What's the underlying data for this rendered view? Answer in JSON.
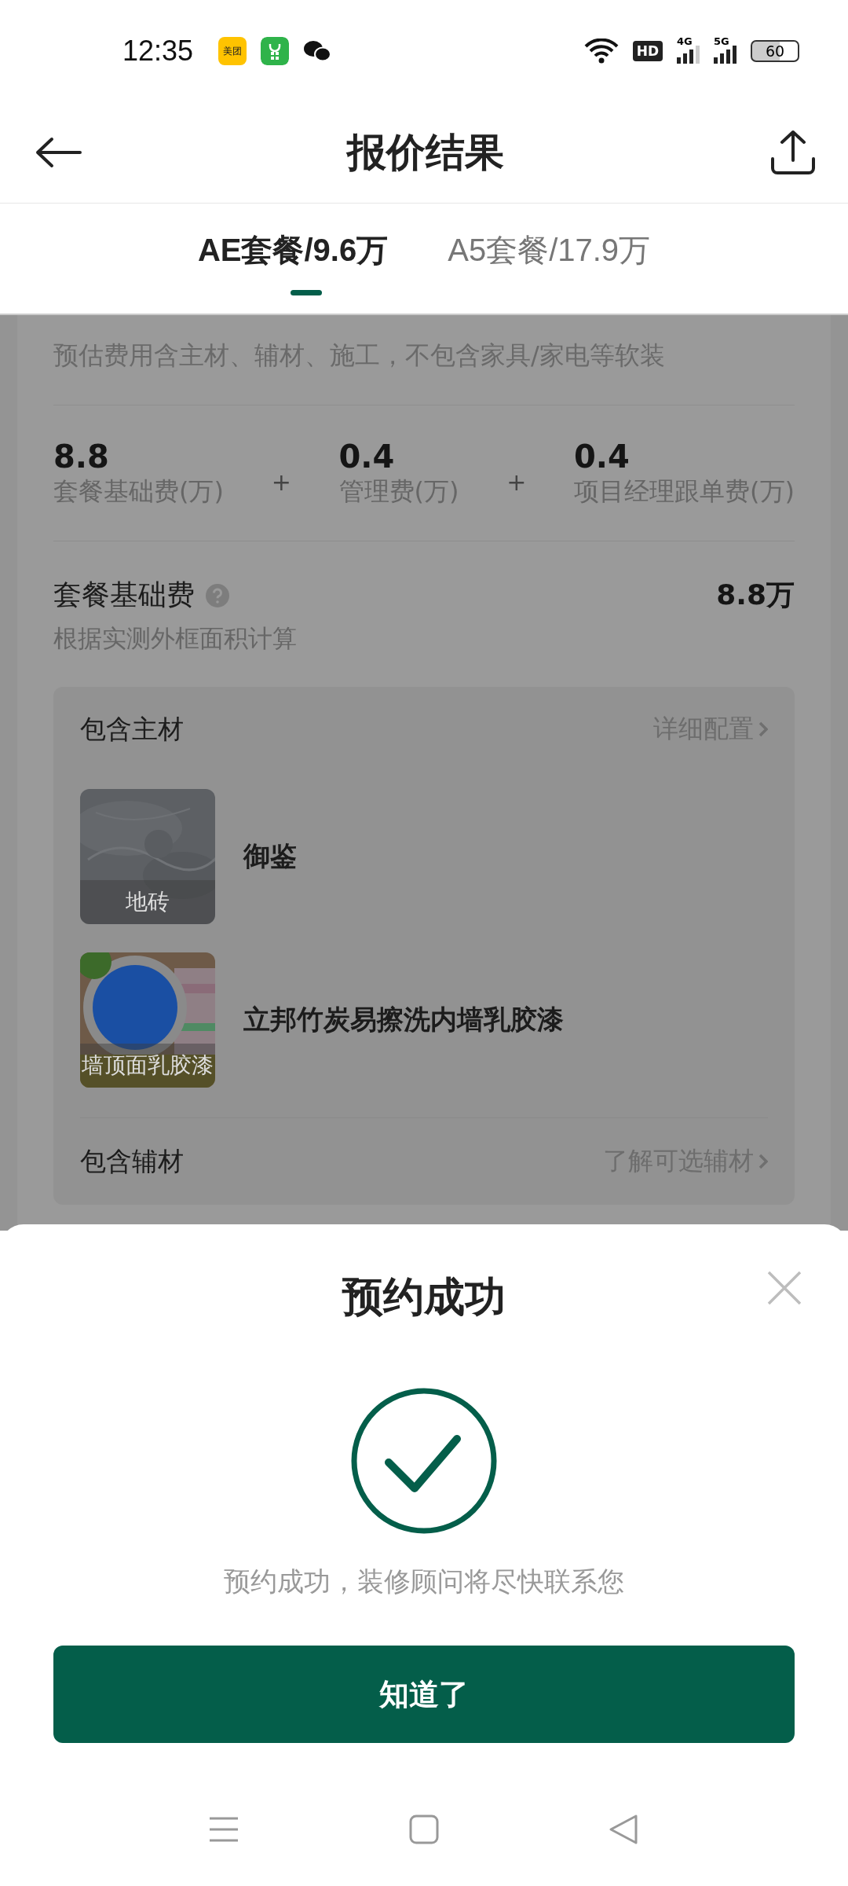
{
  "status_bar": {
    "time": "12:35",
    "app_badge": "美团",
    "hd": "HD",
    "net1": "4G",
    "net2": "5G",
    "battery": "60"
  },
  "header": {
    "title": "报价结果"
  },
  "tabs": [
    {
      "label": "AE套餐/9.6万",
      "selected": true
    },
    {
      "label": "A5套餐/17.9万",
      "selected": false
    }
  ],
  "summary": {
    "description": "预估费用含主材、辅材、施工，不包含家具/家电等软装",
    "fees": [
      {
        "value": "8.8",
        "label": "套餐基础费(万)"
      },
      {
        "operator": "+",
        "value": "0.4",
        "label": "管理费(万)"
      },
      {
        "operator": "+",
        "value": "0.4",
        "label": "项目经理跟单费(万)"
      }
    ]
  },
  "base_fee": {
    "title": "套餐基础费",
    "value": "8.8万",
    "note": "根据实测外框面积计算"
  },
  "main_materials": {
    "title": "包含主材",
    "link": "详细配置",
    "items": [
      {
        "kind": "tile",
        "category": "地砖",
        "name": "御鉴"
      },
      {
        "kind": "paint",
        "category": "墙顶面乳胶漆",
        "name": "立邦竹炭易擦洗内墙乳胶漆"
      }
    ]
  },
  "aux_materials": {
    "title": "包含辅材",
    "link": "了解可选辅材"
  },
  "modal": {
    "title": "预约成功",
    "message": "预约成功，装修顾问将尽快联系您",
    "button": "知道了"
  }
}
